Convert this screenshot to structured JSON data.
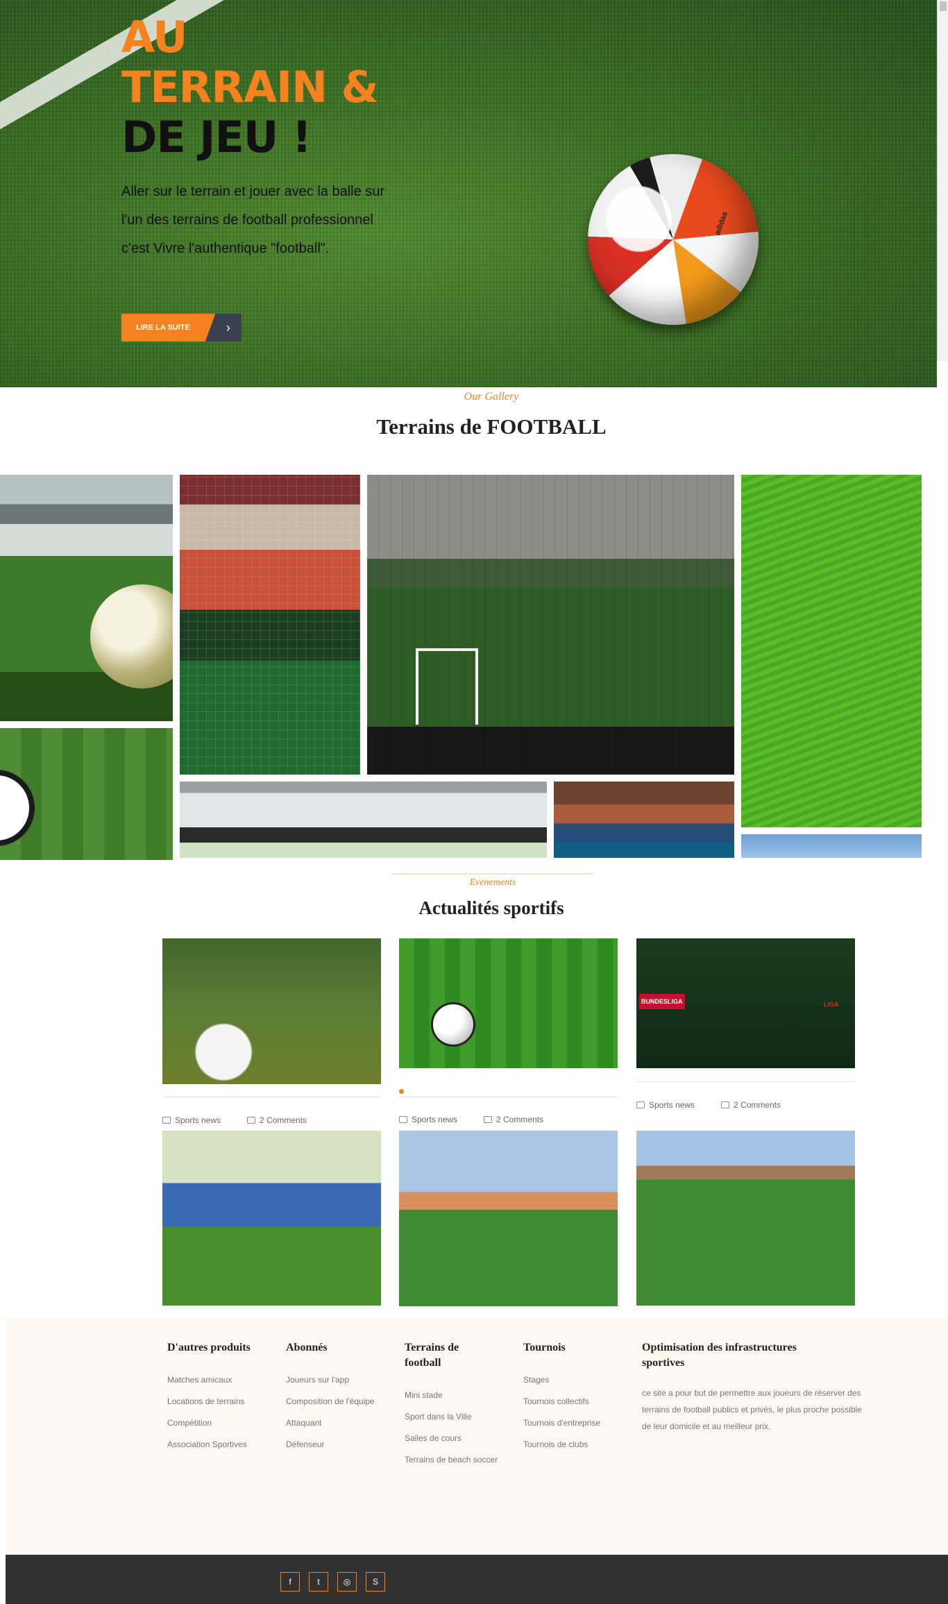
{
  "hero": {
    "title_orange_1": "AU",
    "title_orange_2": "TERRAIN &",
    "title_dark": "DE JEU !",
    "text": "Aller sur le terrain et jouer avec la balle sur l'un des terrains de football professionnel c'est Vivre l'authentique \"football\".",
    "cta_label": "LIRE LA SUITE",
    "cta_arrow": "›",
    "ball_brand": "adidas"
  },
  "gallery": {
    "kicker": "Our Gallery",
    "title": "Terrains de FOOTBALL"
  },
  "news": {
    "kicker": "Evenements",
    "title": "Actualités sportifs",
    "cards": [
      {
        "category": "Sports news",
        "comments": "2 Comments"
      },
      {
        "category": "Sports news",
        "comments": "2 Comments"
      },
      {
        "category": "Sports news",
        "comments": "2 Comments"
      }
    ],
    "card3_logo_left": "BUNDESLIGA",
    "card3_logo_right": "LIGA"
  },
  "footer": {
    "col1": {
      "title": "D'autres produits",
      "items": [
        "Matches amicaux",
        "Locations de terrains",
        "Compétition",
        "Association Sportives"
      ]
    },
    "col2": {
      "title": "Abonnés",
      "items": [
        "Joueurs sur l'app",
        "Composition de l'équipe",
        "Attaquant",
        "Défenseur"
      ]
    },
    "col3": {
      "title_line1": "Terrains de",
      "title_line2": "football",
      "items": [
        "Mini stade",
        "Sport dans la Ville",
        "Salles de cours",
        "Terrains de beach soccer"
      ]
    },
    "col4": {
      "title": "Tournois",
      "items": [
        "Stages",
        "Tournois collectifs",
        "Tournois d'entreprise",
        "Tournois de clubs"
      ]
    },
    "col5": {
      "title_line1": "Optimisation des infrastructures",
      "title_line2": "sportives",
      "text": "ce site a pour but de permettre aux joueurs de réserver des terrains de football publics et privés, le plus proche possible de leur domicile et au meilleur prix."
    }
  },
  "social": {
    "facebook": "f",
    "twitter": "t",
    "instagram": "◎",
    "skype": "S"
  },
  "colors": {
    "accent": "#f5821f",
    "dark_bar": "#323232",
    "footer_bg": "#fdf6f1"
  }
}
